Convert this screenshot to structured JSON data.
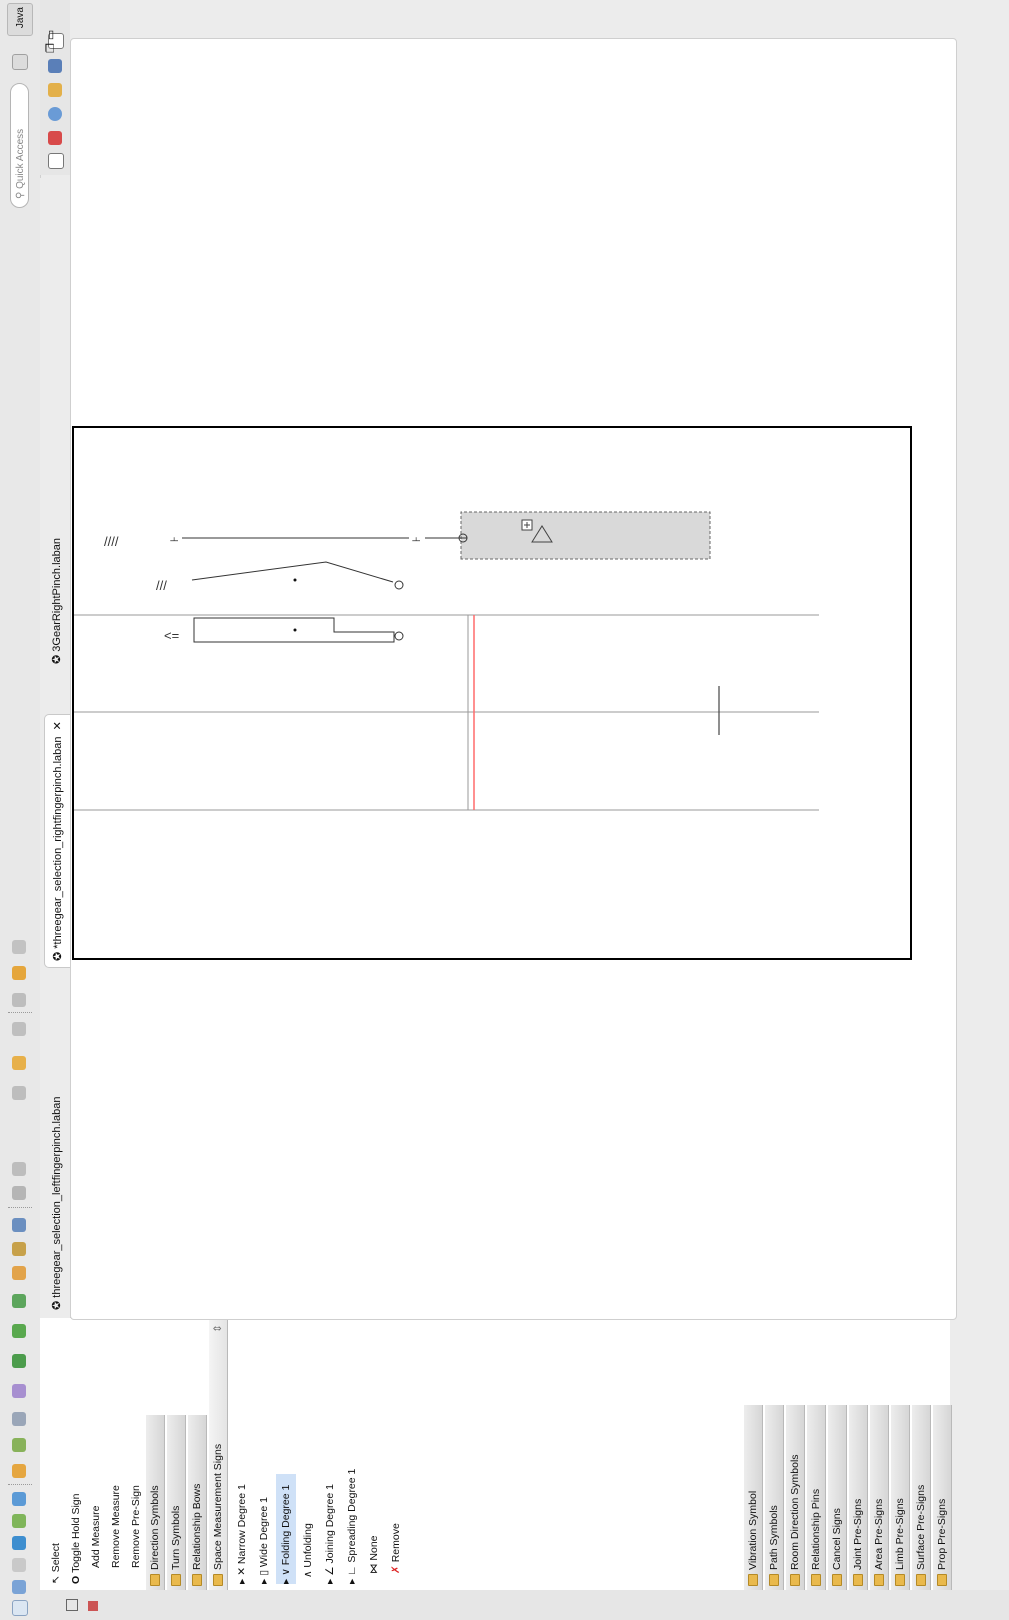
{
  "toolbar": {
    "quick_access_placeholder": "Quick Access",
    "perspective_label": "Java"
  },
  "palette": {
    "tools": [
      {
        "label": "Select"
      },
      {
        "label": "Toggle Hold Sign"
      },
      {
        "label": "Add Measure"
      },
      {
        "label": "Remove Measure"
      },
      {
        "label": "Remove Pre-Sign"
      }
    ],
    "drawers_top": [
      "Direction Symbols",
      "Turn Symbols",
      "Relationship Bows",
      "Space Measurement Signs"
    ],
    "space_items": [
      {
        "label": "Narrow Degree 1"
      },
      {
        "label": "Wide Degree 1"
      },
      {
        "label": "Folding Degree 1"
      },
      {
        "label": "Unfolding"
      },
      {
        "label": "Joining Degree 1"
      },
      {
        "label": "Spreading Degree 1"
      },
      {
        "label": "None"
      },
      {
        "label": "Remove"
      }
    ],
    "drawers_bottom": [
      "Vibration Symbol",
      "Path Symbols",
      "Room Direction Symbols",
      "Relationship Pins",
      "Cancel Signs",
      "Joint Pre-Signs",
      "Area Pre-Signs",
      "Limb Pre-Signs",
      "Surface Pre-Signs",
      "Prop Pre-Signs"
    ]
  },
  "tabs": [
    {
      "label": "threegear_selection_leftfingerpinch.laban"
    },
    {
      "label": "*threegear_selection_rightfingerpinch.laban"
    },
    {
      "label": "3GearRightPinch.laban"
    }
  ],
  "colors": {
    "selection_fill": "#cfe1f7",
    "red_line": "#ff6b6b",
    "staff_line": "#9a9a9a",
    "folder": "#e9b94c"
  }
}
